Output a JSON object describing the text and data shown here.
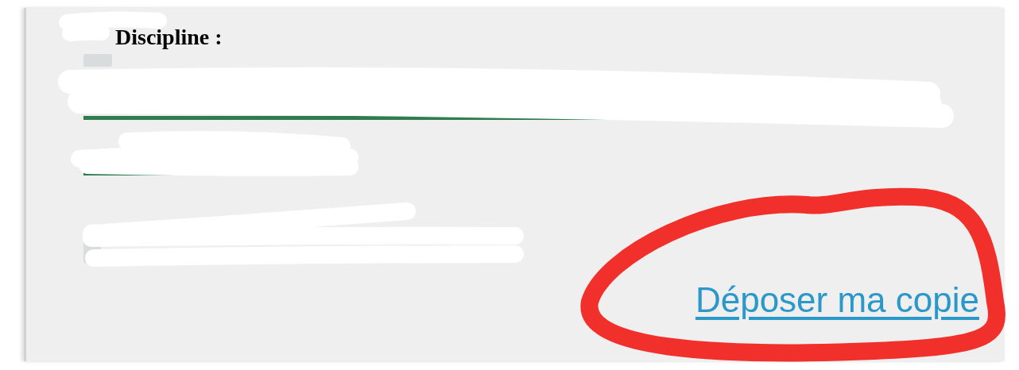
{
  "heading": "Discipline :",
  "link": {
    "label": "Déposer ma copie"
  }
}
